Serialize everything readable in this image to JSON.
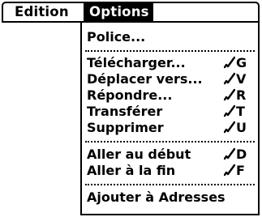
{
  "menubar": {
    "menus": [
      {
        "label": "Edition"
      },
      {
        "label": "Options"
      }
    ]
  },
  "options_menu": {
    "items": [
      {
        "label": "Police..."
      },
      {
        "label": "Télécharger...",
        "shortcut": "G"
      },
      {
        "label": "Déplacer vers...",
        "shortcut": "V"
      },
      {
        "label": "Répondre...",
        "shortcut": "R"
      },
      {
        "label": "Transférer",
        "shortcut": "T"
      },
      {
        "label": "Supprimer",
        "shortcut": "U"
      },
      {
        "label": "Aller au début",
        "shortcut": "D"
      },
      {
        "label": "Aller à la fin",
        "shortcut": "F"
      },
      {
        "label": "Ajouter à Adresses"
      }
    ],
    "shortcut_icon": "graffiti-command-stroke-icon"
  },
  "colors": {
    "foreground": "#000000",
    "background": "#ffffff",
    "highlight": "#000000"
  }
}
